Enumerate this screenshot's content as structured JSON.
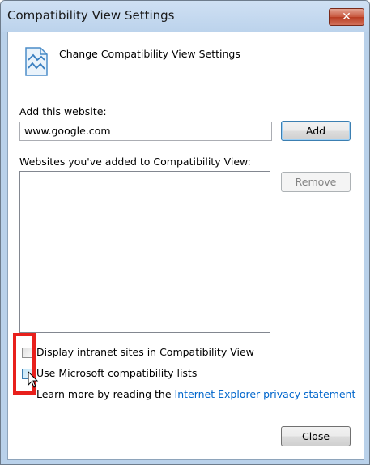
{
  "window": {
    "title": "Compatibility View Settings",
    "close_glyph": "✕"
  },
  "header": {
    "icon": "compatibility-page-icon",
    "title": "Change Compatibility View Settings"
  },
  "add_website": {
    "label": "Add this website:",
    "value": "www.google.com",
    "button": "Add"
  },
  "websites_list": {
    "label": "Websites you've added to Compatibility View:",
    "items": [],
    "remove_button": "Remove"
  },
  "options": {
    "intranet": {
      "label": "Display intranet sites in Compatibility View",
      "checked": false
    },
    "ms_lists": {
      "label": "Use Microsoft compatibility lists",
      "checked": false
    }
  },
  "learn_more": {
    "prefix": "Learn more by reading the ",
    "link": "Internet Explorer privacy statement"
  },
  "footer": {
    "close_button": "Close"
  },
  "colors": {
    "titlebar": "#bcd3ec",
    "highlight": "#e8201c",
    "link": "#0066cc"
  }
}
